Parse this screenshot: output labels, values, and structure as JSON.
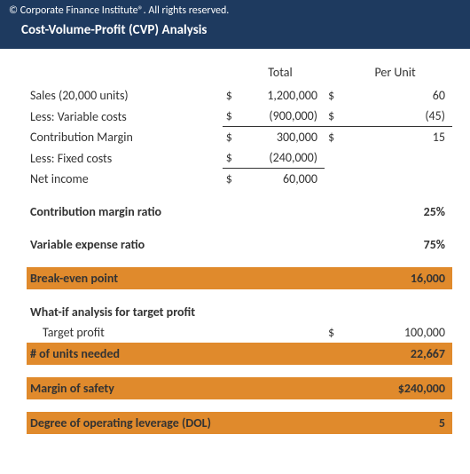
{
  "header": {
    "copyright": "© Corporate Finance Institute®. All rights reserved.",
    "title": "Cost-Volume-Profit (CVP) Analysis"
  },
  "columns": {
    "total": "Total",
    "per_unit": "Per Unit"
  },
  "rows": {
    "sales": {
      "label": "Sales (20,000 units)",
      "cur1": "$",
      "val1": "1,200,000",
      "cur2": "$",
      "val2": "60"
    },
    "varcost": {
      "label": "Less: Variable costs",
      "cur1": "$",
      "val1": "(900,000)",
      "cur2": "$",
      "val2": "(45)"
    },
    "cm": {
      "label": "Contribution Margin",
      "cur1": "$",
      "val1": "300,000",
      "cur2": "$",
      "val2": "15"
    },
    "fixed": {
      "label": "Less: Fixed costs",
      "cur1": "$",
      "val1": "(240,000)",
      "cur2": "",
      "val2": ""
    },
    "ni": {
      "label": "Net income",
      "cur1": "$",
      "val1": "60,000",
      "cur2": "",
      "val2": ""
    }
  },
  "ratios": {
    "cm_ratio": {
      "label": "Contribution margin ratio",
      "value": "25%"
    },
    "var_ratio": {
      "label": "Variable expense ratio",
      "value": "75%"
    }
  },
  "breakeven": {
    "label": "Break-even point",
    "value": "16,000"
  },
  "whatif": {
    "heading": "What-if analysis for target profit",
    "target": {
      "label": "Target profit",
      "cur": "$",
      "value": "100,000"
    },
    "units": {
      "label": "# of units needed",
      "value": "22,667"
    }
  },
  "mos": {
    "label": "Margin of safety",
    "value": "$240,000"
  },
  "dol": {
    "label": "Degree of operating leverage (DOL)",
    "value": "5"
  }
}
